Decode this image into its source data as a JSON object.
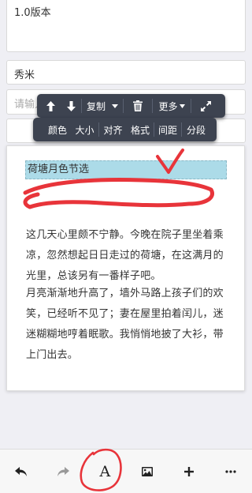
{
  "form": {
    "version_value": "1.0版本",
    "author_value": "秀米",
    "input_placeholder": "请输入"
  },
  "toolbar_top": {
    "copy_label": "复制",
    "more_label": "更多",
    "icons": [
      "arrow-up-icon",
      "arrow-down-icon",
      "caret-down-icon",
      "trash-icon",
      "expand-icon"
    ]
  },
  "toolbar_bottom": {
    "items": [
      "颜色",
      "大小",
      "对齐",
      "格式",
      "间距",
      "分段"
    ]
  },
  "editor": {
    "title": "荷塘月色节选",
    "paragraphs": [
      "这几天心里颇不宁静。今晚在院子里坐着乘凉，忽然想起日日走过的荷塘，在这满月的光里，总该另有一番样子吧。",
      "月亮渐渐地升高了，墙外马路上孩子们的欢笑，已经听不见了；妻在屋里拍着闰儿，迷迷糊糊地哼着眠歌。我悄悄地披了大衫，带上门出去。"
    ]
  },
  "bottom_bar": {
    "buttons": [
      "undo-icon",
      "redo-icon",
      "text-format-icon",
      "image-icon",
      "add-icon",
      "more-icon"
    ],
    "text_button_glyph": "A"
  },
  "colors": {
    "toolbar_bg": "#3d4350",
    "selection": "#acdbe8",
    "annotation": "#e8343a",
    "page_bg": "#efeff4"
  }
}
